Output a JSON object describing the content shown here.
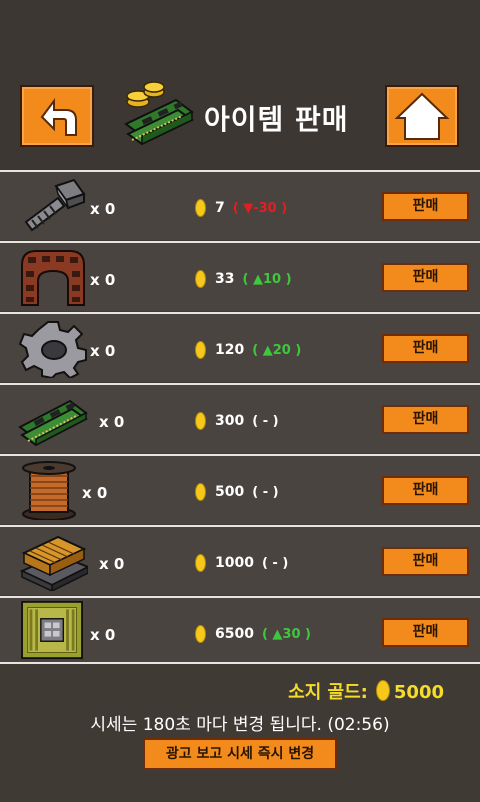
{
  "header": {
    "title": "아이템 판매",
    "back_icon": "back-arrow-icon",
    "home_icon": "home-icon"
  },
  "items": [
    {
      "name_icon": "bolt-icon",
      "qty": "x 0",
      "price": "7",
      "change": "( ▼-30 )",
      "trend": "down",
      "sell_label": "판매"
    },
    {
      "name_icon": "brick-arch-icon",
      "qty": "x 0",
      "price": "33",
      "change": "( ▲10 )",
      "trend": "up",
      "sell_label": "판매"
    },
    {
      "name_icon": "gear-icon",
      "qty": "x 0",
      "price": "120",
      "change": "( ▲20 )",
      "trend": "up",
      "sell_label": "판매"
    },
    {
      "name_icon": "circuit-board-icon",
      "qty": "x 0",
      "price": "300",
      "change": "( - )",
      "trend": "flat",
      "sell_label": "판매"
    },
    {
      "name_icon": "copper-coil-icon",
      "qty": "x 0",
      "price": "500",
      "change": "( - )",
      "trend": "flat",
      "sell_label": "판매"
    },
    {
      "name_icon": "gold-wire-block-icon",
      "qty": "x 0",
      "price": "1000",
      "change": "( - )",
      "trend": "flat",
      "sell_label": "판매"
    },
    {
      "name_icon": "microchip-icon",
      "qty": "x 0",
      "price": "6500",
      "change": "( ▲30 )",
      "trend": "up",
      "sell_label": "판매"
    }
  ],
  "footer": {
    "gold_label": "소지 골드:",
    "gold_value": "5000",
    "info_text": "시세는 180초 마다 변경 됩니다. (02:56)",
    "ad_button_label": "광고 보고 시세 즉시 변경"
  },
  "colors": {
    "accent": "#f28a1c",
    "up": "#3ec83e",
    "down": "#e02020",
    "gold": "#f6dc2a"
  }
}
